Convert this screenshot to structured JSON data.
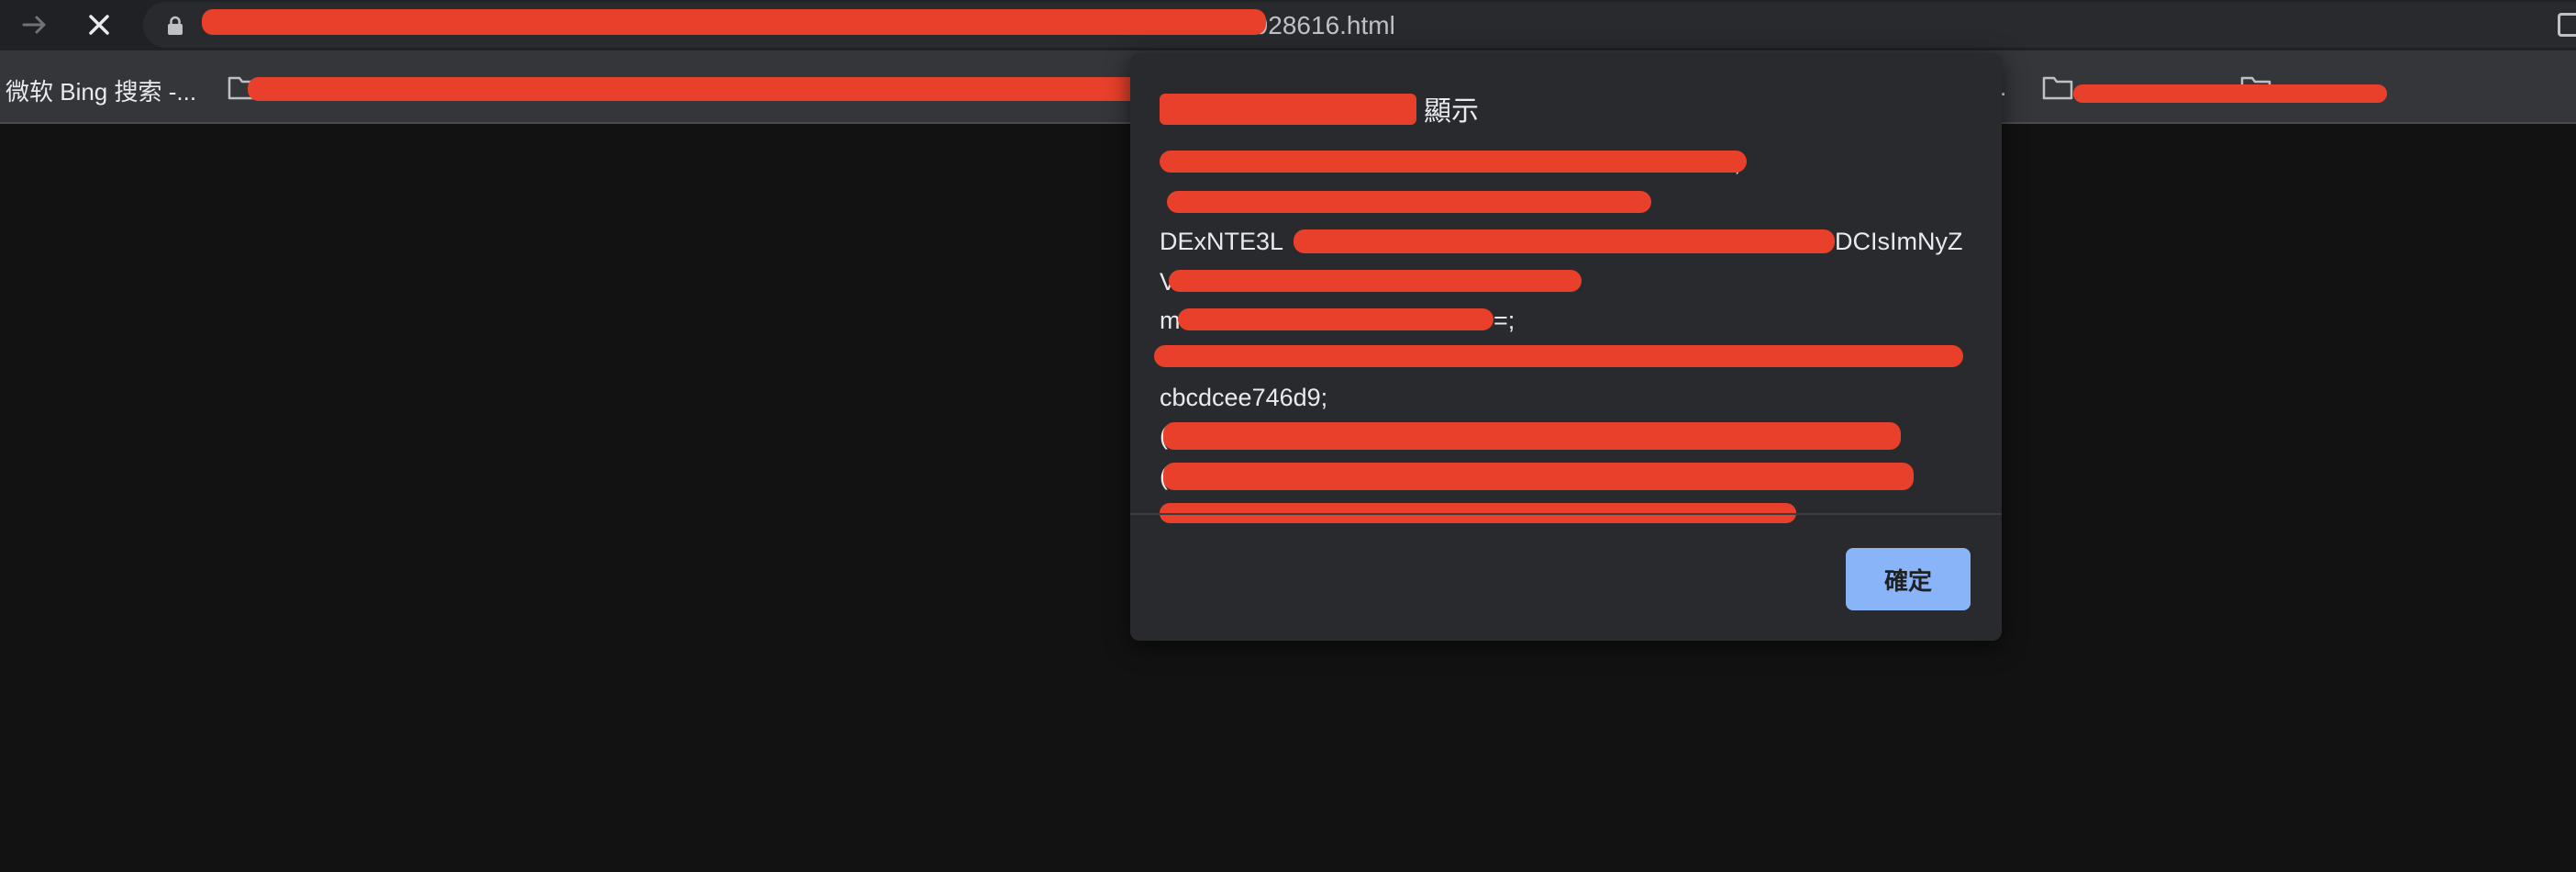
{
  "browser": {
    "url_visible": "083928616.html"
  },
  "bookmarks": {
    "items": [
      {
        "label": "微软 Bing 搜索 -..."
      },
      {
        "label": "."
      }
    ]
  },
  "dialog": {
    "title": "顯示",
    "message_lines": [
      ";",
      "DExNTE3L",
      "DCIsImNyZ",
      "V",
      "m",
      "=;",
      "cbcdcee746d9;",
      "(",
      "("
    ],
    "ok_label": "確定"
  },
  "colors": {
    "accent_button": "#8ab4f8",
    "redaction": "#e8402a",
    "dialog_bg": "#292a2d",
    "page_bg": "#121212"
  }
}
